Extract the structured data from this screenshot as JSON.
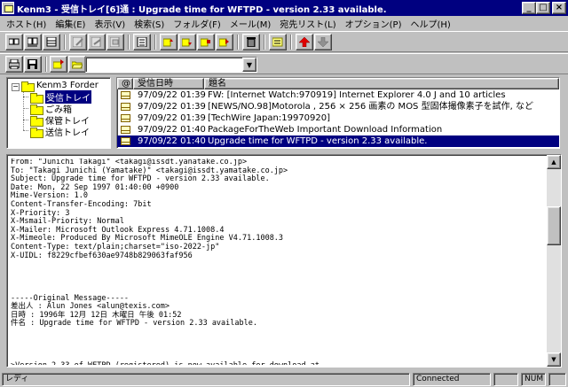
{
  "window": {
    "title": "Kenm3 - 受信トレイ[6]通 : Upgrade time for WFTPD - version 2.33 available.",
    "min_glyph": "_",
    "max_glyph": "□",
    "close_glyph": "×"
  },
  "menu": [
    "ホスト(H)",
    "編集(E)",
    "表示(V)",
    "検索(S)",
    "フォルダ(F)",
    "メール(M)",
    "宛先リスト(L)",
    "オプション(P)",
    "ヘルプ(H)"
  ],
  "folder_select": {
    "value": ""
  },
  "folder_tree": {
    "root": "Kenm3 Forder",
    "folders": [
      "受信トレイ",
      "ごみ箱",
      "保管トレイ",
      "送信トレイ"
    ],
    "selected": "受信トレイ"
  },
  "message_list": {
    "headers": {
      "flag": "@",
      "date": "受信日時",
      "subject": "題名"
    },
    "rows": [
      {
        "date": "97/09/22 01:39",
        "subject": "FW: [Internet Watch:970919] Internet Explorer 4.0 J and 10 articles"
      },
      {
        "date": "97/09/22 01:39",
        "subject": "[NEWS/NO.98]Motorola , 256 × 256 画素の MOS 型固体撮像素子を試作, など"
      },
      {
        "date": "97/09/22 01:39",
        "subject": "[TechWire Japan:19970920]"
      },
      {
        "date": "97/09/22 01:40",
        "subject": "PackageForTheWeb Important Download Information"
      },
      {
        "date": "97/09/22 01:40",
        "subject": "Upgrade time for WFTPD - version 2.33 available."
      }
    ]
  },
  "message_body": "From: \"Junichi Takagi\" <takagi@issdt.yanatake.co.jp>\nTo: \"Takagi Junichi (Yamatake)\" <takagi@issdt.yamatake.co.jp>\nSubject: Upgrade time for WFTPD - version 2.33 available.\nDate: Mon, 22 Sep 1997 01:40:00 +0900\nMime-Version: 1.0\nContent-Transfer-Encoding: 7bit\nX-Priority: 3\nX-Msmail-Priority: Normal\nX-Mailer: Microsoft Outlook Express 4.71.1008.4\nX-Mimeole: Produced By Microsoft MimeOLE Engine V4.71.1008.3\nContent-Type: text/plain;charset=\"iso-2022-jp\"\nX-UIDL: f8229cfbef630ae9748b829063faf956\n\n\n\n\n-----Original Message-----\n差出人 : Alun Jones <alun@texis.com>\n日時 : 1996年 12月 12日 木曜日 午後 01:52\n件名 : Upgrade time for WFTPD - version 2.33 available.\n\n\n\n\n>Version 2.33 of WFTPD (registered) is now available for download at",
  "status": {
    "ready": "レディ",
    "connection": "Connected",
    "num": "NUM"
  }
}
